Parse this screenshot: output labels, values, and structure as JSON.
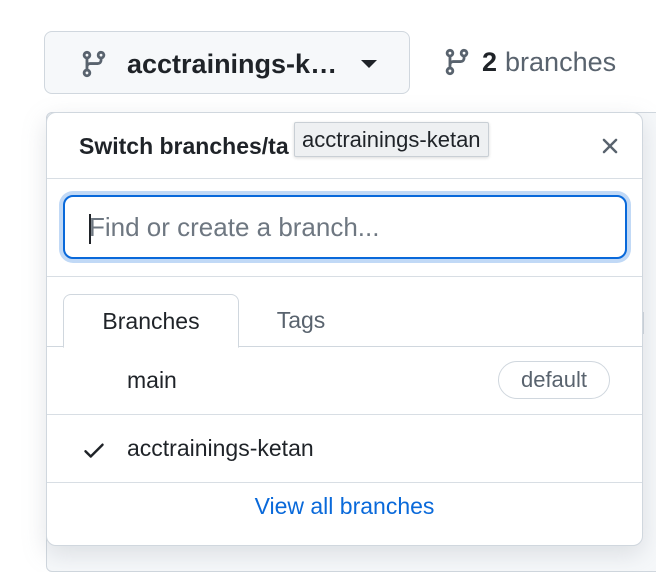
{
  "branch_button": {
    "label": "acctrainings-k…",
    "icon": "git-branch-icon",
    "caret_icon": "triangle-down-icon"
  },
  "branches_link": {
    "count": "2",
    "label": "branches",
    "icon": "git-branch-icon"
  },
  "popover": {
    "title": "Switch branches/ta",
    "close_icon": "x-icon",
    "tooltip": "acctrainings-ketan",
    "search": {
      "value": "",
      "placeholder": "Find or create a branch..."
    },
    "tabs": [
      {
        "label": "Branches",
        "selected": true
      },
      {
        "label": "Tags",
        "selected": false
      }
    ],
    "items": [
      {
        "name": "main",
        "badge": "default",
        "checked": false
      },
      {
        "name": "acctrainings-ketan",
        "checked": true,
        "check_icon": "check-icon"
      }
    ],
    "footer_link": "View all branches"
  },
  "colors": {
    "accent": "#0969da",
    "text": "#1f2328",
    "muted": "#59636e",
    "border": "#d0d7de"
  }
}
